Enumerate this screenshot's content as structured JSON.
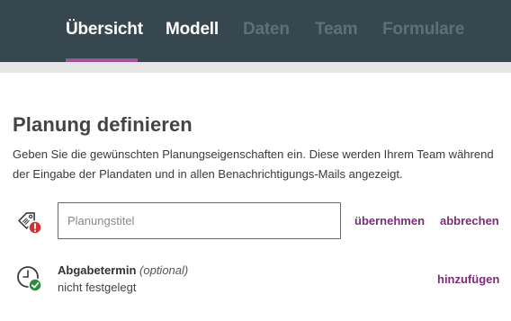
{
  "nav": {
    "tabs": [
      {
        "label": "Übersicht",
        "state": "active"
      },
      {
        "label": "Modell",
        "state": "enabled"
      },
      {
        "label": "Daten",
        "state": "disabled"
      },
      {
        "label": "Team",
        "state": "disabled"
      },
      {
        "label": "Formulare",
        "state": "disabled"
      }
    ],
    "accent_color": "#a0559a",
    "bar_color": "#37474f"
  },
  "main": {
    "title": "Planung definieren",
    "description": "Geben Sie die gewünschten Planungseigenschaften ein. Diese werden Ihrem Team während der Eingabe der Plandaten und in allen Benachrichtigungs-Mails angezeigt."
  },
  "planning_title": {
    "icon": "tag-warning-icon",
    "placeholder": "Planungstitel",
    "value": "",
    "accept_label": "übernehmen",
    "cancel_label": "abbrechen"
  },
  "deadline": {
    "icon": "clock-check-icon",
    "label": "Abgabetermin",
    "optional_label": "(optional)",
    "value": "nicht festgelegt",
    "add_label": "hinzufügen"
  },
  "colors": {
    "link": "#7a2d79",
    "warning": "#d32f2f",
    "success": "#2e8b3a"
  }
}
